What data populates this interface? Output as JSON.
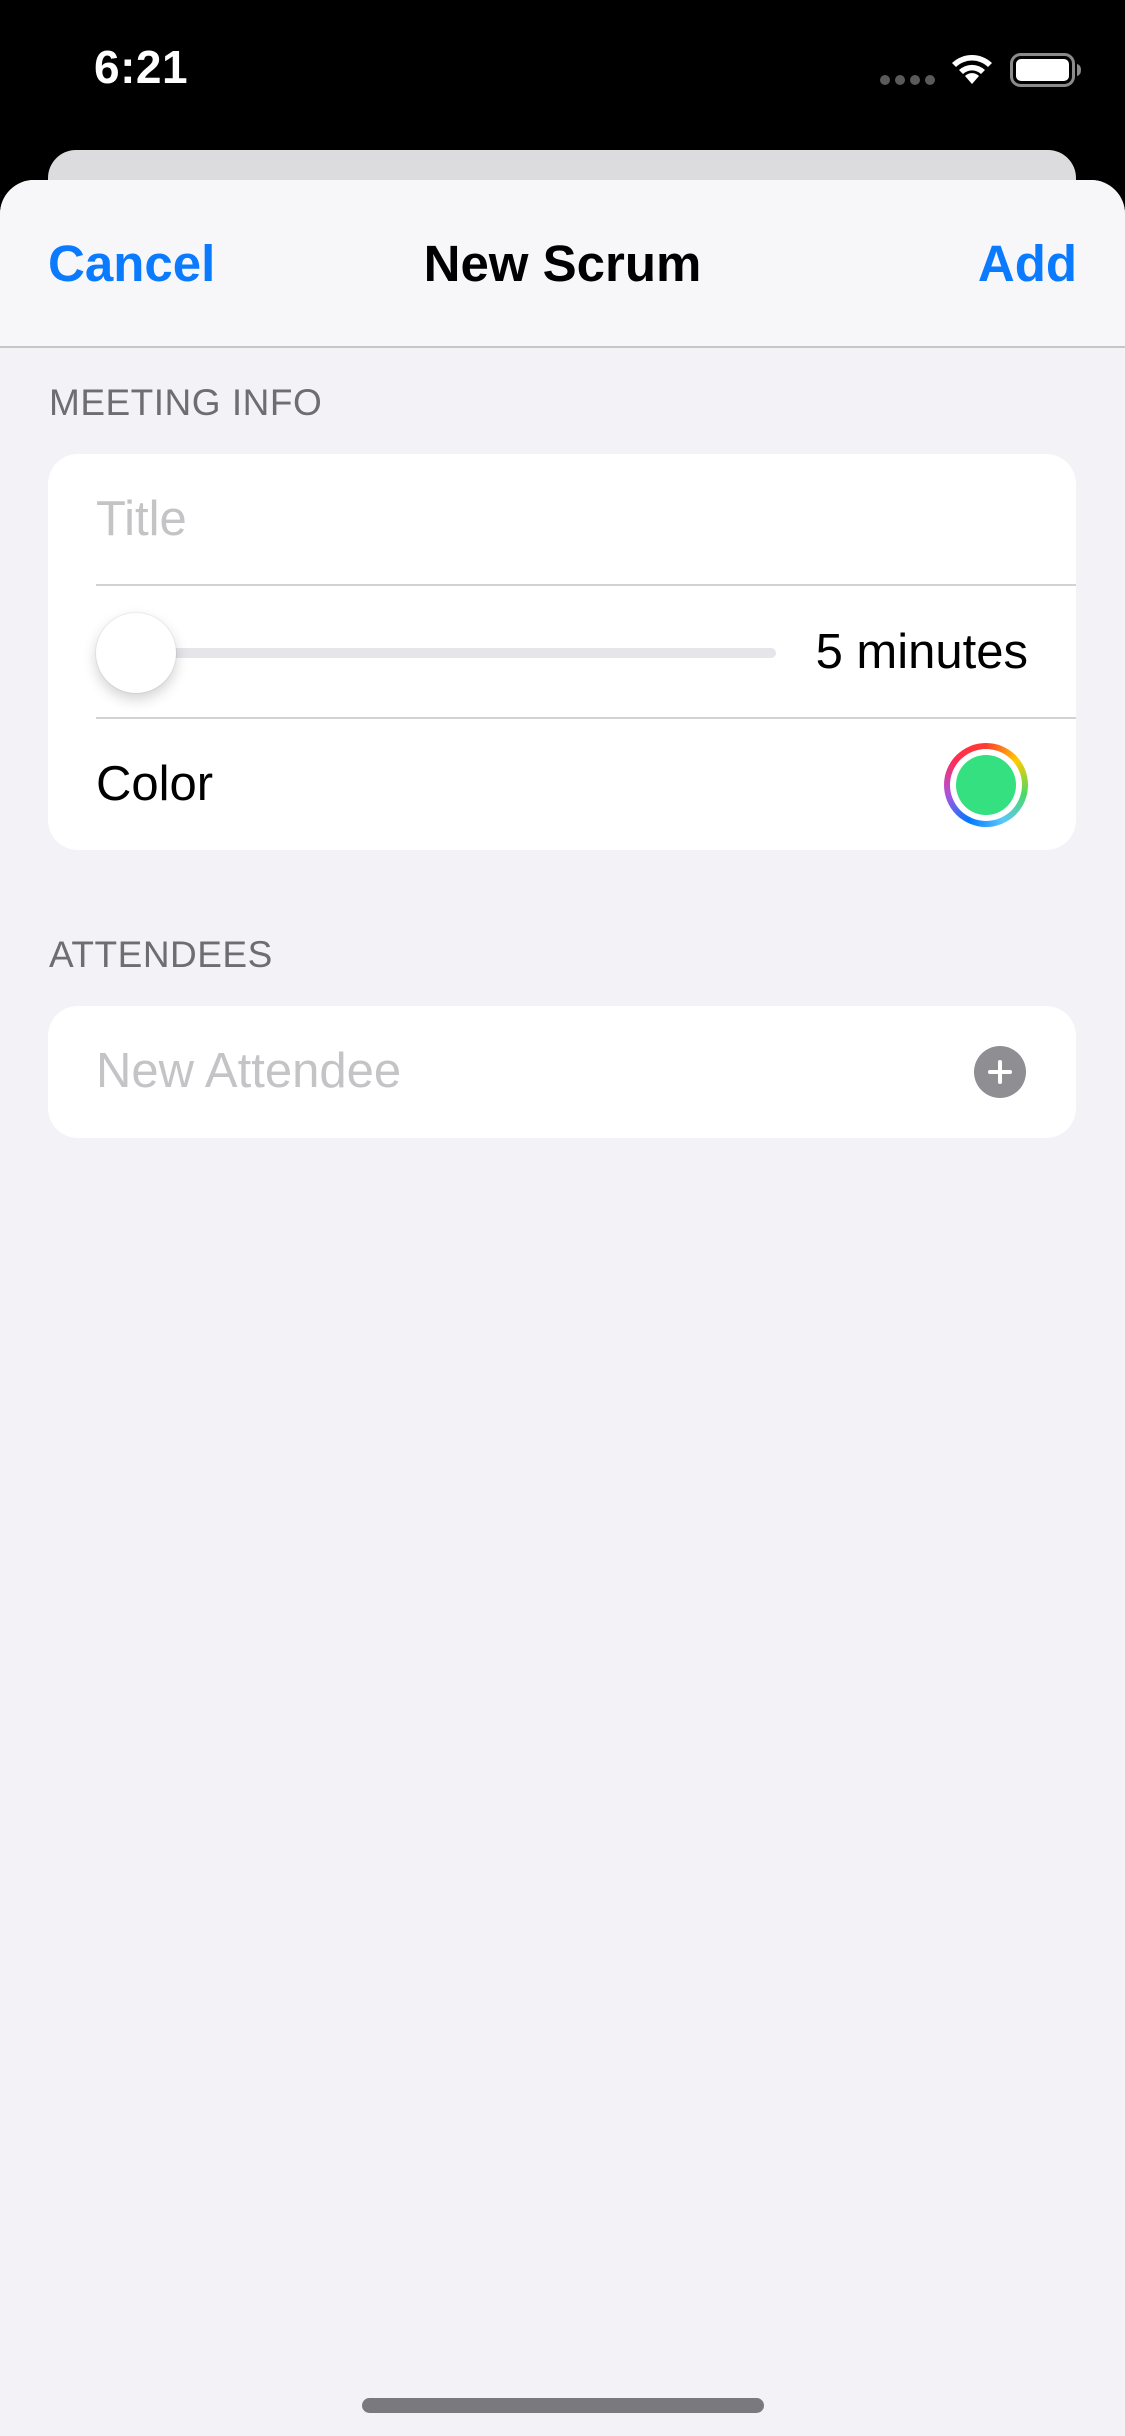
{
  "status_bar": {
    "time": "6:21",
    "cellular_icon": "cellular-dots-icon",
    "wifi_icon": "wifi-icon",
    "battery_icon": "battery-icon"
  },
  "nav": {
    "cancel_label": "Cancel",
    "title": "New Scrum",
    "add_label": "Add",
    "accent_color": "#0a7aff"
  },
  "meeting_info": {
    "header": "MEETING INFO",
    "title_field": {
      "value": "",
      "placeholder": "Title"
    },
    "length_slider": {
      "value_label": "5 minutes",
      "level_fraction": 0.0
    },
    "color_row": {
      "label": "Color",
      "selected_color": "#34e07f"
    }
  },
  "attendees": {
    "header": "ATTENDEES",
    "new_attendee_field": {
      "value": "",
      "placeholder": "New Attendee"
    },
    "add_button_icon": "plus-circle-icon"
  }
}
